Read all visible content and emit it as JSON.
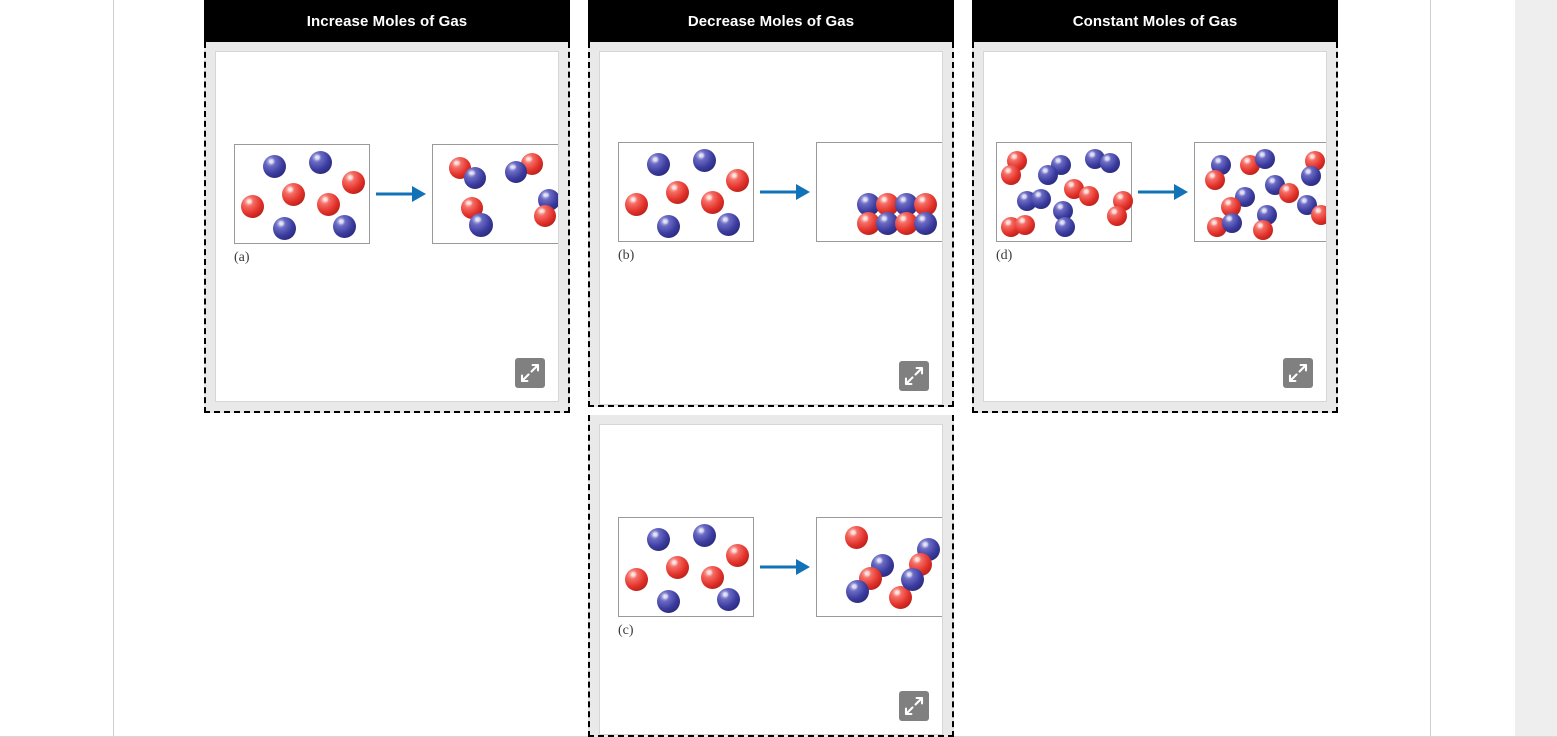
{
  "page": {
    "background_color": "#ffffff",
    "accent_blue": "#1272b8",
    "atom_red": "#e23129",
    "atom_blue": "#3b3b9e",
    "header_bg": "#000000",
    "header_text_color": "#ffffff"
  },
  "columns": [
    {
      "id": "increase",
      "header": "Increase Moles of Gas",
      "panels": [
        {
          "label": "(a)",
          "expand_icon": "expand-arrows-icon",
          "before": {
            "caption": "4 blue atoms and 4 red atoms as separate gas particles",
            "atom_count": 8,
            "particle_count": 8
          },
          "after": {
            "caption": "4 red-blue diatomic molecules",
            "atom_count": 8,
            "particle_count": 4
          }
        }
      ]
    },
    {
      "id": "decrease",
      "header": "Decrease Moles of Gas",
      "panels": [
        {
          "label": "(b)",
          "expand_icon": "expand-arrows-icon",
          "before": {
            "caption": "4 blue atoms and 4 red atoms as separate gas particles",
            "atom_count": 8,
            "particle_count": 8
          },
          "after": {
            "caption": "Condensed solid cluster of 4 red-blue pairs",
            "atom_count": 8,
            "particle_count": 0
          }
        },
        {
          "label": "(c)",
          "expand_icon": "expand-arrows-icon",
          "before": {
            "caption": "4 blue atoms and 4 red atoms as separate gas particles",
            "atom_count": 8,
            "particle_count": 8
          },
          "after": {
            "caption": "2 blue-red-blue triatomic molecules and 2 free red atoms",
            "atom_count": 8,
            "particle_count": 4
          }
        }
      ]
    },
    {
      "id": "constant",
      "header": "Constant Moles of Gas",
      "panels": [
        {
          "label": "(d)",
          "expand_icon": "expand-arrows-icon",
          "before": {
            "caption": "4 red-red and 4 blue-blue diatomic molecules",
            "atom_count": 16,
            "particle_count": 8
          },
          "after": {
            "caption": "8 red-blue diatomic molecules",
            "atom_count": 16,
            "particle_count": 8
          }
        }
      ]
    }
  ]
}
